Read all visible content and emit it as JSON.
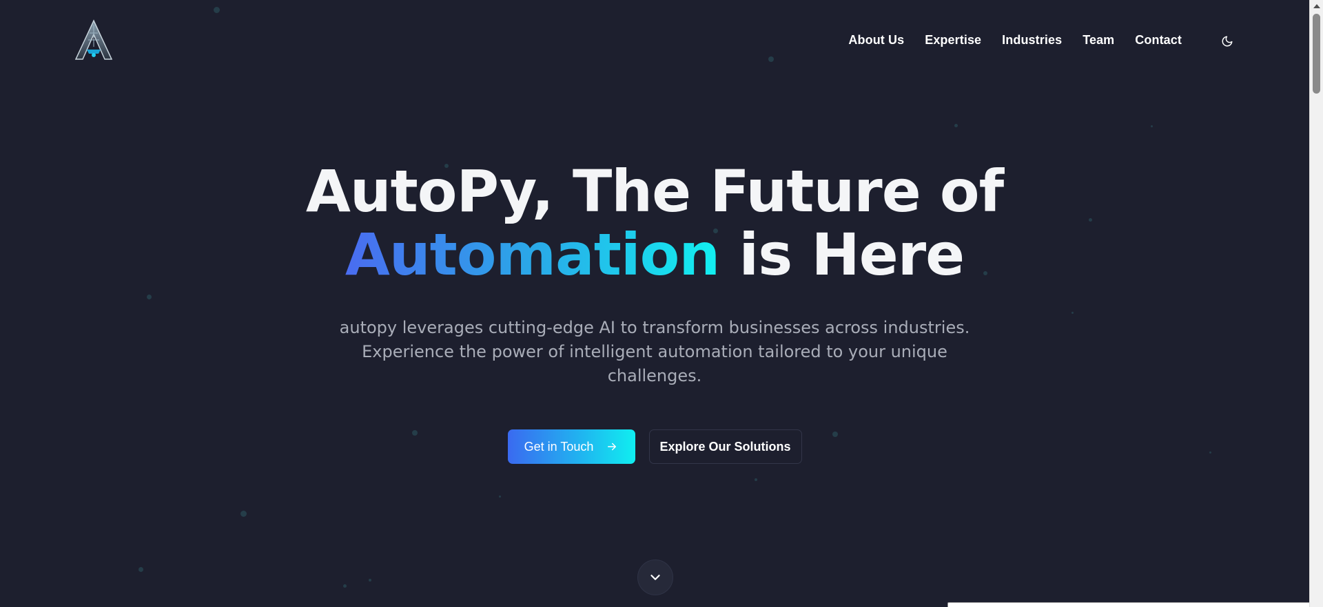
{
  "header": {
    "logo_icon": "autopy-a-logo",
    "nav": [
      {
        "label": "About Us"
      },
      {
        "label": "Expertise"
      },
      {
        "label": "Industries"
      },
      {
        "label": "Team"
      },
      {
        "label": "Contact"
      }
    ],
    "theme_toggle_icon": "moon-icon"
  },
  "hero": {
    "headline_line1": "AutoPy, The Future of",
    "headline_highlight": "Automation",
    "headline_line2_rest": " is Here",
    "subtitle_line1": "autopy leverages cutting-edge AI to transform businesses across industries.",
    "subtitle_line2": "Experience the power of intelligent automation tailored to your unique",
    "subtitle_line3": "challenges.",
    "primary_cta": "Get in Touch",
    "primary_cta_icon": "arrow-right-icon",
    "secondary_cta": "Explore Our Solutions",
    "scroll_icon": "chevron-down-icon"
  },
  "colors": {
    "background": "#1d1f2e",
    "gradient_start": "#4a6cf0",
    "gradient_end": "#12f0f0",
    "subtitle": "#a9adb8"
  }
}
